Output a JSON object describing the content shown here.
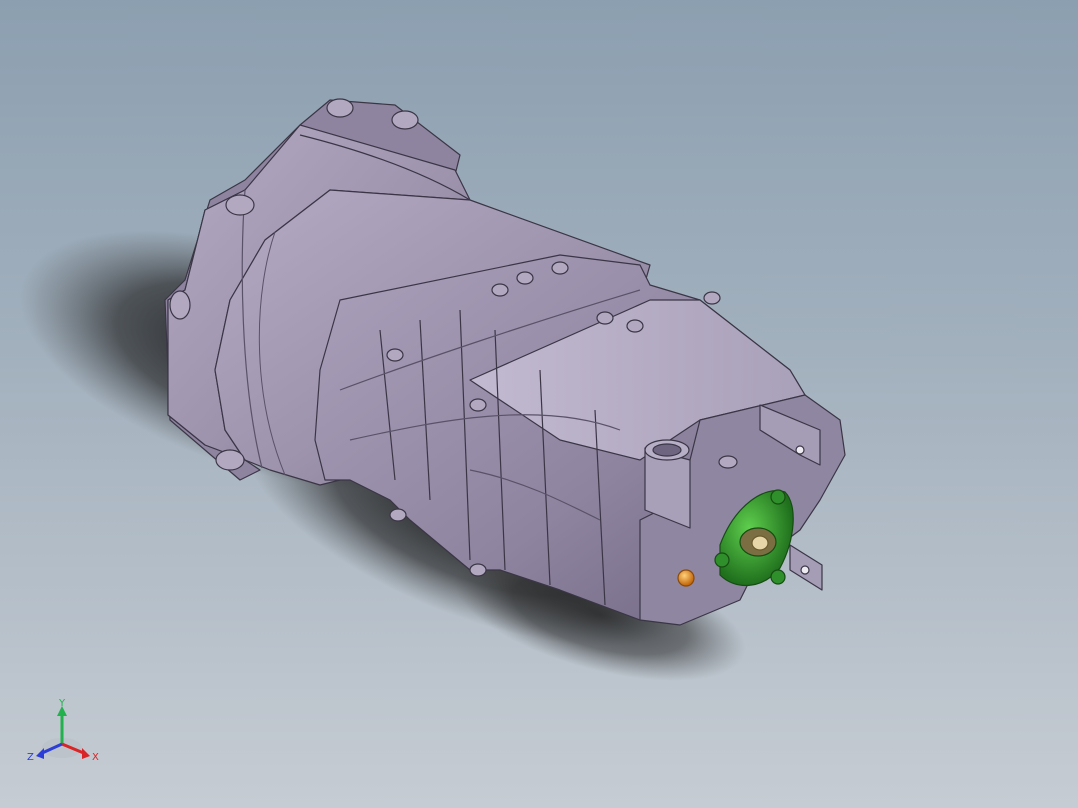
{
  "viewport": {
    "background_top": "#8c9fb0",
    "background_bottom": "#c6ccd3",
    "part_color": "#9f96ad",
    "part_edge_color": "#3b3646",
    "flange_color": "#2f8f2a",
    "bolt_color": "#e08a1e"
  },
  "model": {
    "icon": "gearbox-assembly-icon"
  },
  "triad": {
    "y_label": "Y",
    "x_label": "X",
    "z_label": "Z",
    "y_color": "#22b14c",
    "x_color": "#d92525",
    "z_color": "#2c3ed6"
  }
}
